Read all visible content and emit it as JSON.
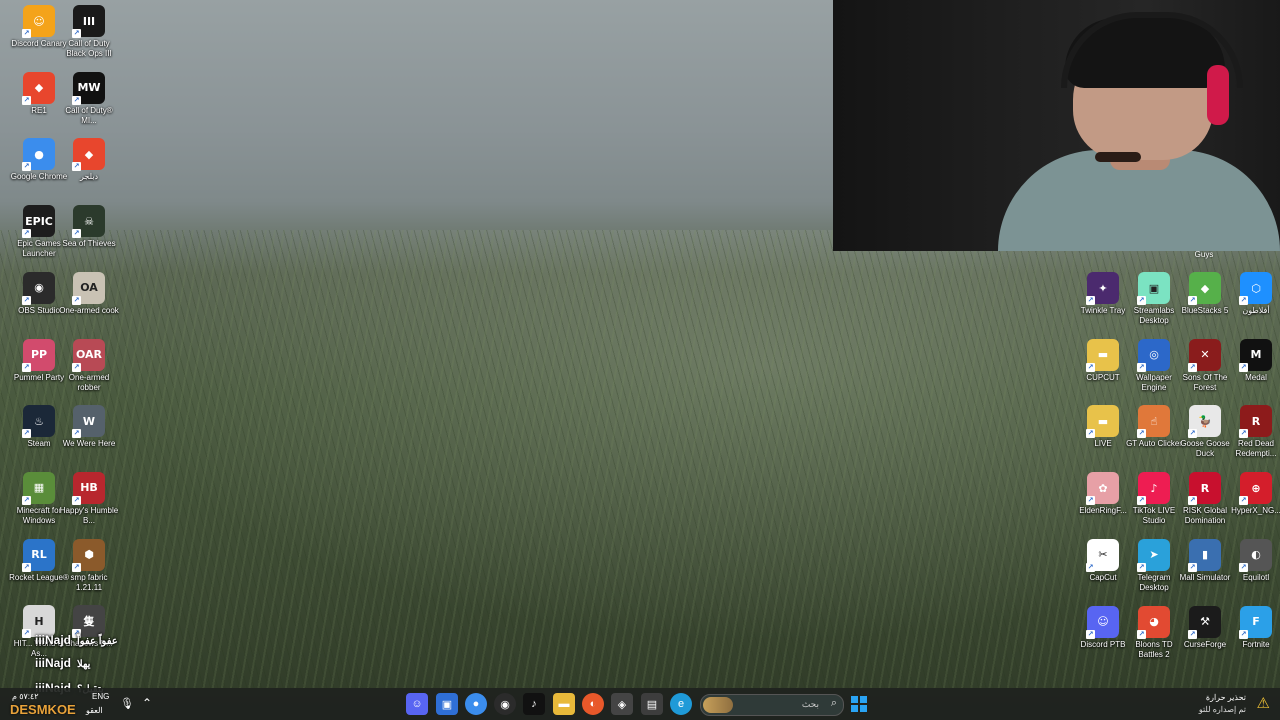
{
  "left_icons": [
    {
      "label": "Discord Canary",
      "col": 0,
      "row": 0,
      "color": "#f4a31a",
      "glyph": "☺",
      "icon": "discord-canary-icon"
    },
    {
      "label": "Call of Duty Black Ops III",
      "col": 1,
      "row": 0,
      "color": "#1a1a1a",
      "glyph": "III",
      "icon": "black-ops-icon"
    },
    {
      "label": "RE1",
      "col": 0,
      "row": 1,
      "color": "#e8462d",
      "glyph": "◆",
      "icon": "brave-icon"
    },
    {
      "label": "Call of Duty® MI...",
      "col": 1,
      "row": 1,
      "color": "#111111",
      "glyph": "MW",
      "icon": "modern-warfare-icon"
    },
    {
      "label": "Google Chrome",
      "col": 0,
      "row": 2,
      "color": "#3b8ded",
      "glyph": "●",
      "icon": "chrome-icon"
    },
    {
      "label": "دبلجر",
      "col": 1,
      "row": 2,
      "color": "#e8462d",
      "glyph": "◆",
      "icon": "brave-icon"
    },
    {
      "label": "Epic Games Launcher",
      "col": 0,
      "row": 3,
      "color": "#1d1d1d",
      "glyph": "EPIC",
      "icon": "epic-games-icon"
    },
    {
      "label": "Sea of Thieves",
      "col": 1,
      "row": 3,
      "color": "#2b3a2c",
      "glyph": "☠",
      "icon": "sea-of-thieves-icon"
    },
    {
      "label": "OBS Studio",
      "col": 0,
      "row": 4,
      "color": "#2b2b2b",
      "glyph": "◉",
      "icon": "obs-icon"
    },
    {
      "label": "One-armed cook",
      "col": 1,
      "row": 4,
      "color": "#c9c2b4",
      "glyph": "OA",
      "icon": "one-armed-cook-icon"
    },
    {
      "label": "Pummel Party",
      "col": 0,
      "row": 5,
      "color": "#d24b6d",
      "glyph": "PP",
      "icon": "pummel-party-icon"
    },
    {
      "label": "One-armed robber",
      "col": 1,
      "row": 5,
      "color": "#b84a55",
      "glyph": "OAR",
      "icon": "one-armed-robber-icon"
    },
    {
      "label": "Steam",
      "col": 0,
      "row": 6,
      "color": "#1b2838",
      "glyph": "♨",
      "icon": "steam-icon"
    },
    {
      "label": "We Were Here",
      "col": 1,
      "row": 6,
      "color": "#55616b",
      "glyph": "W",
      "icon": "we-were-here-icon"
    },
    {
      "label": "Minecraft for Windows",
      "col": 0,
      "row": 7,
      "color": "#5a8d3a",
      "glyph": "▦",
      "icon": "minecraft-icon"
    },
    {
      "label": "Happy's Humble B...",
      "col": 1,
      "row": 7,
      "color": "#b8272e",
      "glyph": "HB",
      "icon": "humble-icon"
    },
    {
      "label": "Rocket League®",
      "col": 0,
      "row": 8,
      "color": "#2b74c9",
      "glyph": "RL",
      "icon": "rocket-league-icon"
    },
    {
      "label": "smp fabric 1.21.11",
      "col": 1,
      "row": 8,
      "color": "#8b5a2b",
      "glyph": "⬢",
      "icon": "smp-fabric-icon"
    },
    {
      "label": "HIT... World of As...",
      "col": 0,
      "row": 9,
      "color": "#d8d8d8",
      "glyph": "H",
      "icon": "hitman-icon"
    },
    {
      "label": "Shadows D...",
      "col": 1,
      "row": 9,
      "color": "#444444",
      "glyph": "隻",
      "icon": "sekiro-icon"
    }
  ],
  "right_icons": [
    {
      "label": "Twinkle Tray",
      "col": 0,
      "row": 0,
      "color": "#4b2a6e",
      "glyph": "✦",
      "icon": "twinkle-tray-icon"
    },
    {
      "label": "Streamlabs Desktop",
      "col": 1,
      "row": 0,
      "color": "#7be3c2",
      "glyph": "▣",
      "icon": "streamlabs-icon"
    },
    {
      "label": "BlueStacks 5",
      "col": 2,
      "row": 0,
      "color": "#56b04a",
      "glyph": "◆",
      "icon": "bluestacks-icon"
    },
    {
      "label": "أفلاطون",
      "col": 3,
      "row": 0,
      "color": "#1e90ff",
      "glyph": "⬡",
      "icon": "dice-icon"
    },
    {
      "label": "CUPCUT",
      "col": 0,
      "row": 1,
      "color": "#e8c24a",
      "glyph": "▬",
      "icon": "folder-icon"
    },
    {
      "label": "Wallpaper Engine",
      "col": 1,
      "row": 1,
      "color": "#2c68c9",
      "glyph": "◎",
      "icon": "wallpaper-engine-icon"
    },
    {
      "label": "Sons Of The Forest",
      "col": 2,
      "row": 1,
      "color": "#8a1c1c",
      "glyph": "✕",
      "icon": "sons-of-forest-icon"
    },
    {
      "label": "Medal",
      "col": 3,
      "row": 1,
      "color": "#111111",
      "glyph": "M",
      "icon": "medal-icon"
    },
    {
      "label": "LIVE",
      "col": 0,
      "row": 2,
      "color": "#e8c24a",
      "glyph": "▬",
      "icon": "folder-icon"
    },
    {
      "label": "GT Auto Clicker",
      "col": 1,
      "row": 2,
      "color": "#e0783a",
      "glyph": "☝",
      "icon": "auto-clicker-icon"
    },
    {
      "label": "Goose Goose Duck",
      "col": 2,
      "row": 2,
      "color": "#e8e8e8",
      "glyph": "🦆",
      "icon": "goose-icon"
    },
    {
      "label": "Red Dead Redempti...",
      "col": 3,
      "row": 2,
      "color": "#8d1b1b",
      "glyph": "R",
      "icon": "red-dead-icon"
    },
    {
      "label": "EldenRingF...",
      "col": 0,
      "row": 3,
      "color": "#e7a0a6",
      "glyph": "✿",
      "icon": "elden-ring-icon"
    },
    {
      "label": "TikTok LIVE Studio",
      "col": 1,
      "row": 3,
      "color": "#ee1d52",
      "glyph": "♪",
      "icon": "tiktok-icon"
    },
    {
      "label": "RISK Global Domination",
      "col": 2,
      "row": 3,
      "color": "#c8102e",
      "glyph": "R",
      "icon": "risk-icon"
    },
    {
      "label": "HyperX_NG...",
      "col": 3,
      "row": 3,
      "color": "#d41e2b",
      "glyph": "⊕",
      "icon": "hyperx-icon"
    },
    {
      "label": "CapCut",
      "col": 0,
      "row": 4,
      "color": "#ffffff",
      "glyph": "✂",
      "icon": "capcut-icon"
    },
    {
      "label": "Telegram Desktop",
      "col": 1,
      "row": 4,
      "color": "#2aa1da",
      "glyph": "➤",
      "icon": "telegram-icon"
    },
    {
      "label": "Mall Simulator",
      "col": 2,
      "row": 4,
      "color": "#3a6fb0",
      "glyph": "▮",
      "icon": "mall-simulator-icon"
    },
    {
      "label": "Equilotl",
      "col": 3,
      "row": 4,
      "color": "#555555",
      "glyph": "◐",
      "icon": "equilotl-icon"
    },
    {
      "label": "Discord PTB",
      "col": 0,
      "row": 5,
      "color": "#5865f2",
      "glyph": "☺",
      "icon": "discord-ptb-icon"
    },
    {
      "label": "Bloons TD Battles 2",
      "col": 1,
      "row": 5,
      "color": "#e24a32",
      "glyph": "◕",
      "icon": "bloons-icon"
    },
    {
      "label": "CurseForge",
      "col": 2,
      "row": 5,
      "color": "#1b1b1b",
      "glyph": "⚒",
      "icon": "curseforge-icon"
    },
    {
      "label": "Fortnite",
      "col": 3,
      "row": 5,
      "color": "#2ba0e8",
      "glyph": "F",
      "icon": "fortnite-icon"
    }
  ],
  "partial_label": "Guys",
  "chat": [
    {
      "user": "iiiNajd",
      "message": "عفواً عفواً"
    },
    {
      "user": "iiiNajd",
      "message": "يهلا"
    },
    {
      "user": "iiiNajd",
      "message": "يتقبل؟"
    }
  ],
  "taskbar": {
    "search_placeholder": "بحث",
    "lang": "ENG",
    "time": "٥٧:٤٢ م",
    "date": "العقو",
    "notification_title": "تحذير حرارة",
    "notification_sub": "تم إصداره للتو",
    "watermark": "DESMKOE"
  }
}
